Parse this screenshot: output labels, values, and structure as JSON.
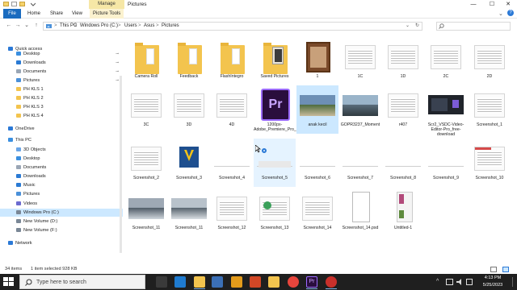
{
  "window": {
    "title": "Pictures",
    "manage_label": "Manage",
    "minimize": "—",
    "maximize": "☐",
    "close": "✕"
  },
  "ribbon": {
    "file": "File",
    "home": "Home",
    "share": "Share",
    "view": "View",
    "picture_tools": "Picture Tools"
  },
  "address": {
    "back": "←",
    "forward": "→",
    "recent": "⌄",
    "up": "↑",
    "crumbs": [
      "This PC",
      "Windows Pro (C:)",
      "Users",
      "Asus",
      "Pictures"
    ],
    "separator": ">",
    "dropdown": "⌄",
    "refresh": "↻"
  },
  "nav": {
    "items": [
      {
        "label": "Quick access",
        "icon": "star-icon",
        "color": "#2b79d6"
      },
      {
        "label": "Desktop",
        "icon": "desktop-icon",
        "color": "#3a8fe0",
        "pinned": true
      },
      {
        "label": "Downloads",
        "icon": "download-icon",
        "color": "#2a7ad4",
        "pinned": true
      },
      {
        "label": "Documents",
        "icon": "documents-icon",
        "color": "#9aa6b5",
        "pinned": true
      },
      {
        "label": "Pictures",
        "icon": "pictures-icon",
        "color": "#4a90d9",
        "pinned": true
      },
      {
        "label": "PH KLS 1",
        "icon": "folder-icon",
        "color": "#f3c44e"
      },
      {
        "label": "PH KLS 2",
        "icon": "folder-icon",
        "color": "#f3c44e"
      },
      {
        "label": "PH KLS 3",
        "icon": "folder-icon",
        "color": "#f3c44e"
      },
      {
        "label": "PH KLS 4",
        "icon": "folder-icon",
        "color": "#f3c44e"
      },
      {
        "label": "OneDrive",
        "icon": "cloud-icon",
        "color": "#2b79d6"
      },
      {
        "label": "This PC",
        "icon": "computer-icon",
        "color": "#3a8fe0"
      },
      {
        "label": "3D Objects",
        "icon": "cube-icon",
        "color": "#6aa5e6"
      },
      {
        "label": "Desktop",
        "icon": "desktop-icon",
        "color": "#3a8fe0"
      },
      {
        "label": "Documents",
        "icon": "documents-icon",
        "color": "#9aa6b5"
      },
      {
        "label": "Downloads",
        "icon": "download-icon",
        "color": "#2a7ad4"
      },
      {
        "label": "Music",
        "icon": "music-icon",
        "color": "#2a7ad4"
      },
      {
        "label": "Pictures",
        "icon": "pictures-icon",
        "color": "#4a90d9"
      },
      {
        "label": "Videos",
        "icon": "video-icon",
        "color": "#6b6bd0"
      },
      {
        "label": "Windows Pro (C:)",
        "icon": "drive-icon",
        "color": "#7a8796"
      },
      {
        "label": "New Volume (D:)",
        "icon": "drive-icon",
        "color": "#7a8796"
      },
      {
        "label": "New Volume (F:)",
        "icon": "drive-icon",
        "color": "#7a8796"
      },
      {
        "label": "Network",
        "icon": "network-icon",
        "color": "#2b79d6"
      }
    ],
    "pin_glyph": "📌"
  },
  "files": [
    {
      "name": "Camera Roll",
      "kind": "folder"
    },
    {
      "name": "Feedback",
      "kind": "folder"
    },
    {
      "name": "FlashIntegro",
      "kind": "folder"
    },
    {
      "name": "Saved Pictures",
      "kind": "folder"
    },
    {
      "name": "1",
      "kind": "image"
    },
    {
      "name": "1C",
      "kind": "screenshot"
    },
    {
      "name": "1D",
      "kind": "screenshot"
    },
    {
      "name": "2C",
      "kind": "screenshot"
    },
    {
      "name": "2D",
      "kind": "screenshot"
    },
    {
      "name": "3C",
      "kind": "screenshot"
    },
    {
      "name": "3D",
      "kind": "screenshot"
    },
    {
      "name": "4D",
      "kind": "screenshot"
    },
    {
      "name": "1200px-Adobe_Premiere_Pro_Logo.svg_",
      "kind": "premiere"
    },
    {
      "name": "anak kecil",
      "kind": "photo"
    },
    {
      "name": "GOPR3237_Moment",
      "kind": "photo"
    },
    {
      "name": "r407",
      "kind": "screenshot"
    },
    {
      "name": "Scr2_VSDC-Video-Editor-Pro_free-download",
      "kind": "dark"
    },
    {
      "name": "Screenshot_1",
      "kind": "screenshot"
    },
    {
      "name": "Screenshot_2",
      "kind": "screenshot"
    },
    {
      "name": "Screenshot_3",
      "kind": "logo"
    },
    {
      "name": "Screenshot_4",
      "kind": "blank"
    },
    {
      "name": "Screenshot_5",
      "kind": "blank"
    },
    {
      "name": "Screenshot_6",
      "kind": "blank"
    },
    {
      "name": "Screenshot_7",
      "kind": "blank"
    },
    {
      "name": "Screenshot_8",
      "kind": "blank"
    },
    {
      "name": "Screenshot_9",
      "kind": "blank"
    },
    {
      "name": "Screenshot_10",
      "kind": "screenshot"
    },
    {
      "name": "Screenshot_11",
      "kind": "photo"
    },
    {
      "name": "Screenshot_11",
      "kind": "photo"
    },
    {
      "name": "Screenshot_12",
      "kind": "screenshot"
    },
    {
      "name": "Screenshot_13",
      "kind": "screenshot"
    },
    {
      "name": "Screenshot_14",
      "kind": "screenshot"
    },
    {
      "name": "Screenshot_14.psd",
      "kind": "document"
    },
    {
      "name": "Untitled-1",
      "kind": "mixed"
    }
  ],
  "status": {
    "count": "34 items",
    "selection": "1 item selected  928 KB"
  },
  "taskbar": {
    "search_placeholder": "Type here to search",
    "time": "4:13 PM",
    "date": "5/25/2023",
    "tray_chevron": "^",
    "apps": [
      "task-view-icon",
      "edge-icon",
      "file-explorer-icon",
      "store-icon",
      "winamp-icon",
      "office-icon",
      "folder-icon",
      "chrome-icon",
      "premiere-icon",
      "recorder-icon"
    ]
  },
  "colors": {
    "accent": "#1a6bbf",
    "selected": "#cce8ff",
    "taskbar": "#1f1f1f",
    "manage": "#f6e7a6"
  }
}
